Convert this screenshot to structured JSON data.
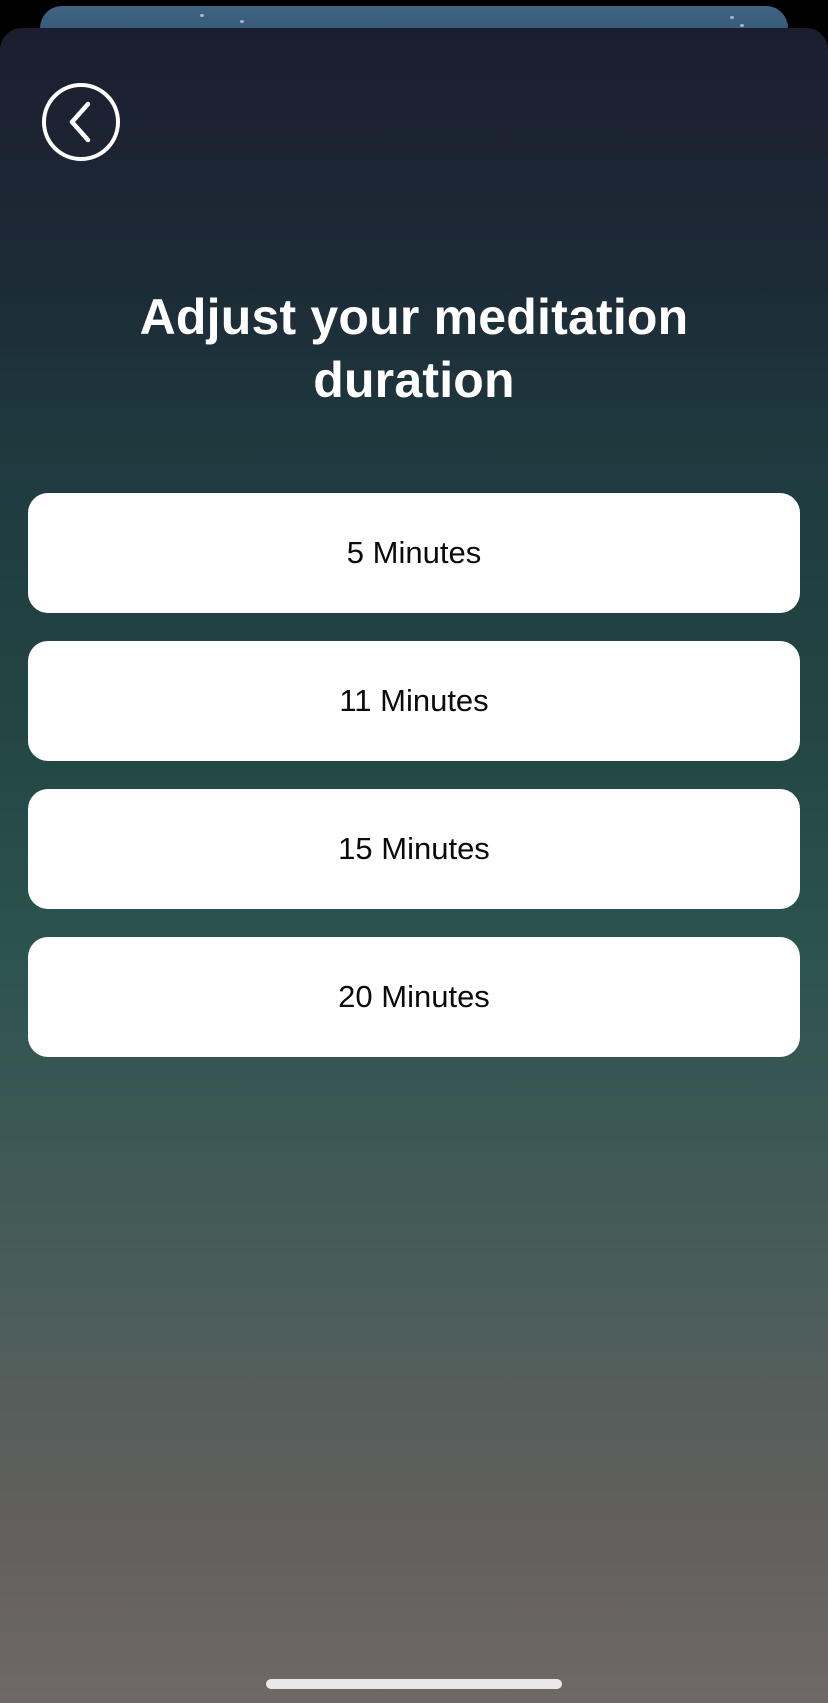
{
  "header": {
    "back_icon": "chevron-left-icon"
  },
  "title": "Adjust your meditation duration",
  "options": [
    {
      "label": "5 Minutes"
    },
    {
      "label": "11 Minutes"
    },
    {
      "label": "15 Minutes"
    },
    {
      "label": "20 Minutes"
    }
  ],
  "colors": {
    "sheet_top": "#1b1e2f",
    "sheet_mid": "#234643",
    "sheet_bottom": "#6e6966",
    "option_bg": "#ffffff",
    "option_text": "#0b0b0b",
    "title_text": "#ffffff"
  }
}
